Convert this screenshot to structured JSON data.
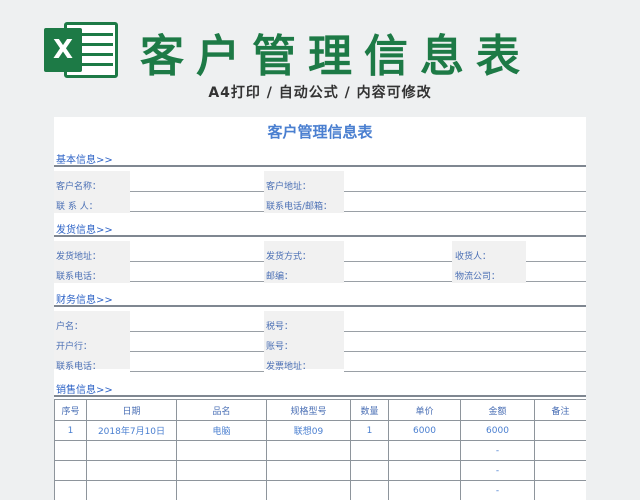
{
  "header": {
    "logo_letter": "X",
    "title": "客户管理信息表",
    "subtitle": "A4打印 / 自动公式 / 内容可修改"
  },
  "sheet": {
    "title": "客户管理信息表",
    "sections": {
      "basic": "基本信息>>",
      "shipping": "发货信息>>",
      "finance": "财务信息>>",
      "sales": "销售信息>>"
    },
    "basic_fields": {
      "customer_name": "客户名称：",
      "customer_address": "客户地址：",
      "contact": "联 系 人：",
      "phone_email": "联系电话/邮箱："
    },
    "shipping_fields": {
      "ship_address": "发货地址：",
      "ship_method": "发货方式：",
      "receiver": "收货人：",
      "phone": "联系电话：",
      "postcode": "邮编：",
      "logistics": "物流公司："
    },
    "finance_fields": {
      "account_name": "户名：",
      "tax_id": "税号：",
      "bank": "开户行：",
      "account_no": "账号：",
      "phone": "联系电话：",
      "invoice_address": "发票地址："
    },
    "sales_table": {
      "headers": [
        "序号",
        "日期",
        "品名",
        "规格型号",
        "数量",
        "单价",
        "金额",
        "备注"
      ],
      "rows": [
        [
          "1",
          "2018年7月10日",
          "电脑",
          "联想09",
          "1",
          "6000",
          "6000",
          ""
        ],
        [
          "",
          "",
          "",
          "",
          "",
          "",
          "-",
          ""
        ],
        [
          "",
          "",
          "",
          "",
          "",
          "",
          "-",
          ""
        ],
        [
          "",
          "",
          "",
          "",
          "",
          "",
          "-",
          ""
        ]
      ]
    }
  },
  "colors": {
    "brand_green": "#1d7a46",
    "blue_text": "#4a7fd0",
    "background": "#eef0f1"
  }
}
